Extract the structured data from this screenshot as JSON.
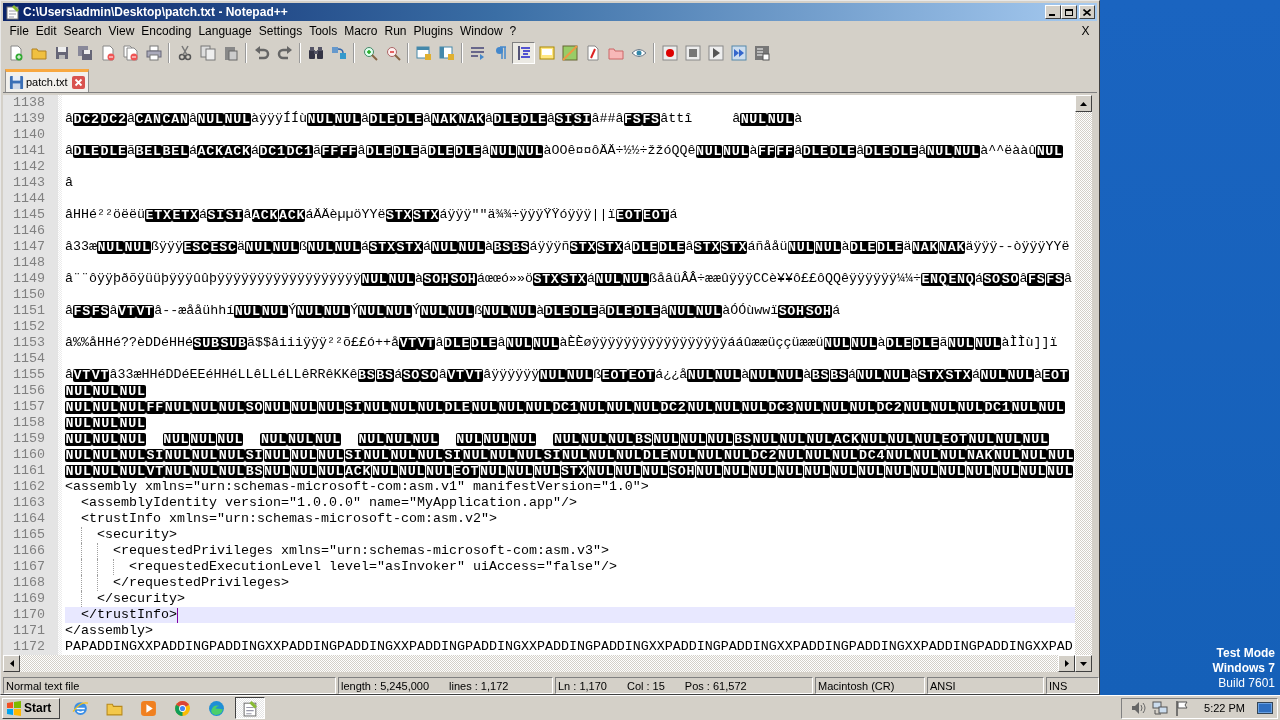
{
  "window": {
    "title": "C:\\Users\\admin\\Desktop\\patch.txt - Notepad++"
  },
  "menu": [
    "File",
    "Edit",
    "Search",
    "View",
    "Encoding",
    "Language",
    "Settings",
    "Tools",
    "Macro",
    "Run",
    "Plugins",
    "Window",
    "?"
  ],
  "menu_close": "X",
  "toolbar": [
    [
      {
        "pressed": false
      },
      {
        "pressed": false
      },
      {
        "pressed": false
      },
      {
        "pressed": false
      },
      {
        "pressed": false
      },
      {
        "pressed": false
      },
      {
        "pressed": false
      }
    ],
    [
      {
        "pressed": false
      },
      {
        "pressed": false
      },
      {
        "pressed": false
      }
    ],
    [
      {
        "pressed": false
      },
      {
        "pressed": false
      }
    ],
    [
      {
        "pressed": false
      },
      {
        "pressed": false
      }
    ],
    [
      {
        "pressed": false
      },
      {
        "pressed": false
      }
    ],
    [
      {
        "pressed": false
      },
      {
        "pressed": false
      }
    ],
    [
      {
        "pressed": false
      },
      {
        "pressed": false
      },
      {
        "pressed": true
      },
      {
        "pressed": false
      },
      {
        "pressed": false
      },
      {
        "pressed": false
      },
      {
        "pressed": false
      },
      {
        "pressed": false
      }
    ],
    [
      {
        "pressed": false
      },
      {
        "pressed": false
      },
      {
        "pressed": false
      },
      {
        "pressed": false
      },
      {
        "pressed": false
      }
    ]
  ],
  "tabs": [
    {
      "label": "patch.txt",
      "selected": true
    }
  ],
  "editor": {
    "lines": [
      {
        "number": "1138",
        "current": false
      },
      {
        "number": "1139",
        "current": false,
        "segments": [
          {
            "kind": "text",
            "text": "â"
          },
          {
            "kind": "ctrl",
            "codes": [
              "DC2",
              "DC2"
            ]
          },
          {
            "kind": "text",
            "text": "â"
          },
          {
            "kind": "ctrl",
            "codes": [
              "CAN",
              "CAN"
            ]
          },
          {
            "kind": "text",
            "text": "â"
          },
          {
            "kind": "ctrl",
            "codes": [
              "NUL",
              "NUL"
            ]
          },
          {
            "kind": "text",
            "text": "àÿÿÿÍÍù"
          },
          {
            "kind": "ctrl",
            "codes": [
              "NUL",
              "NUL"
            ]
          },
          {
            "kind": "text",
            "text": "â"
          },
          {
            "kind": "ctrl",
            "codes": [
              "DLE",
              "DLE"
            ]
          },
          {
            "kind": "text",
            "text": "â"
          },
          {
            "kind": "ctrl",
            "codes": [
              "NAK",
              "NAK"
            ]
          },
          {
            "kind": "text",
            "text": "â"
          },
          {
            "kind": "ctrl",
            "codes": [
              "DLE",
              "DLE"
            ]
          },
          {
            "kind": "text",
            "text": "â"
          },
          {
            "kind": "ctrl",
            "codes": [
              "SI",
              "SI"
            ]
          },
          {
            "kind": "text",
            "text": "â##â"
          },
          {
            "kind": "ctrl",
            "codes": [
              "FS",
              "FS"
            ]
          },
          {
            "kind": "text",
            "text": "âttî     â"
          },
          {
            "kind": "ctrl",
            "codes": [
              "NUL",
              "NUL"
            ]
          },
          {
            "kind": "text",
            "text": "à"
          }
        ]
      },
      {
        "number": "1140",
        "current": false
      },
      {
        "number": "1141",
        "current": false,
        "segments": [
          {
            "kind": "text",
            "text": "â"
          },
          {
            "kind": "ctrl",
            "codes": [
              "DLE",
              "DLE"
            ]
          },
          {
            "kind": "text",
            "text": "ã"
          },
          {
            "kind": "ctrl",
            "codes": [
              "BEL",
              "BEL"
            ]
          },
          {
            "kind": "text",
            "text": "á"
          },
          {
            "kind": "ctrl",
            "codes": [
              "ACK",
              "ACK"
            ]
          },
          {
            "kind": "text",
            "text": "á"
          },
          {
            "kind": "ctrl",
            "codes": [
              "DC1",
              "DC1"
            ]
          },
          {
            "kind": "text",
            "text": "ã"
          },
          {
            "kind": "ctrl",
            "codes": [
              "FF",
              "FF"
            ]
          },
          {
            "kind": "text",
            "text": "â"
          },
          {
            "kind": "ctrl",
            "codes": [
              "DLE",
              "DLE"
            ]
          },
          {
            "kind": "text",
            "text": "ã"
          },
          {
            "kind": "ctrl",
            "codes": [
              "DLE",
              "DLE"
            ]
          },
          {
            "kind": "text",
            "text": "â"
          },
          {
            "kind": "ctrl",
            "codes": [
              "NUL",
              "NUL"
            ]
          },
          {
            "kind": "text",
            "text": "àOOê¤¤ôÄÄ÷½½÷žžóQQê"
          },
          {
            "kind": "ctrl",
            "codes": [
              "NUL",
              "NUL"
            ]
          },
          {
            "kind": "text",
            "text": "à"
          },
          {
            "kind": "ctrl",
            "codes": [
              "FF",
              "FF"
            ]
          },
          {
            "kind": "text",
            "text": "â"
          },
          {
            "kind": "ctrl",
            "codes": [
              "DLE",
              "DLE"
            ]
          },
          {
            "kind": "text",
            "text": "â"
          },
          {
            "kind": "ctrl",
            "codes": [
              "DLE",
              "DLE"
            ]
          },
          {
            "kind": "text",
            "text": "â"
          },
          {
            "kind": "ctrl",
            "codes": [
              "NUL",
              "NUL"
            ]
          },
          {
            "kind": "text",
            "text": "à^^ëààû"
          },
          {
            "kind": "ctrl",
            "codes": [
              "NUL"
            ]
          }
        ]
      },
      {
        "number": "1142",
        "current": false
      },
      {
        "number": "1143",
        "current": false,
        "segments": [
          {
            "kind": "text",
            "text": "â"
          }
        ]
      },
      {
        "number": "1144",
        "current": false
      },
      {
        "number": "1145",
        "current": false,
        "segments": [
          {
            "kind": "text",
            "text": "âHHé²²öëëü"
          },
          {
            "kind": "ctrl",
            "codes": [
              "ETX",
              "ETX"
            ]
          },
          {
            "kind": "text",
            "text": "á"
          },
          {
            "kind": "ctrl",
            "codes": [
              "SI",
              "SI"
            ]
          },
          {
            "kind": "text",
            "text": "â"
          },
          {
            "kind": "ctrl",
            "codes": [
              "ACK",
              "ACK"
            ]
          },
          {
            "kind": "text",
            "text": "áÄÄèµµöYYë"
          },
          {
            "kind": "ctrl",
            "codes": [
              "STX",
              "STX"
            ]
          },
          {
            "kind": "text",
            "text": "áÿÿÿ\"\"ä¾¾÷ÿÿÿŸŸóÿÿÿ||ï"
          },
          {
            "kind": "ctrl",
            "codes": [
              "EOT",
              "EOT"
            ]
          },
          {
            "kind": "text",
            "text": "á"
          }
        ]
      },
      {
        "number": "1146",
        "current": false
      },
      {
        "number": "1147",
        "current": false,
        "segments": [
          {
            "kind": "text",
            "text": "â33æ"
          },
          {
            "kind": "ctrl",
            "codes": [
              "NUL",
              "NUL"
            ]
          },
          {
            "kind": "text",
            "text": "ßÿÿÿ"
          },
          {
            "kind": "ctrl",
            "codes": [
              "ESC",
              "ESC"
            ]
          },
          {
            "kind": "text",
            "text": "ä"
          },
          {
            "kind": "ctrl",
            "codes": [
              "NUL",
              "NUL"
            ]
          },
          {
            "kind": "text",
            "text": "ß"
          },
          {
            "kind": "ctrl",
            "codes": [
              "NUL",
              "NUL"
            ]
          },
          {
            "kind": "text",
            "text": "á"
          },
          {
            "kind": "ctrl",
            "codes": [
              "STX",
              "STX"
            ]
          },
          {
            "kind": "text",
            "text": "á"
          },
          {
            "kind": "ctrl",
            "codes": [
              "NUL",
              "NUL"
            ]
          },
          {
            "kind": "text",
            "text": "à"
          },
          {
            "kind": "ctrl",
            "codes": [
              "BS",
              "BS"
            ]
          },
          {
            "kind": "text",
            "text": "áÿÿÿñ"
          },
          {
            "kind": "ctrl",
            "codes": [
              "STX",
              "STX"
            ]
          },
          {
            "kind": "text",
            "text": "á"
          },
          {
            "kind": "ctrl",
            "codes": [
              "DLE",
              "DLE"
            ]
          },
          {
            "kind": "text",
            "text": "â"
          },
          {
            "kind": "ctrl",
            "codes": [
              "STX",
              "STX"
            ]
          },
          {
            "kind": "text",
            "text": "áñååü"
          },
          {
            "kind": "ctrl",
            "codes": [
              "NUL",
              "NUL"
            ]
          },
          {
            "kind": "text",
            "text": "à"
          },
          {
            "kind": "ctrl",
            "codes": [
              "DLE",
              "DLE"
            ]
          },
          {
            "kind": "text",
            "text": "ä"
          },
          {
            "kind": "ctrl",
            "codes": [
              "NAK",
              "NAK"
            ]
          },
          {
            "kind": "text",
            "text": "äÿÿÿ--òÿÿÿYYë"
          }
        ]
      },
      {
        "number": "1148",
        "current": false
      },
      {
        "number": "1149",
        "current": false,
        "segments": [
          {
            "kind": "text",
            "text": "â¨¨ôÿÿþðõÿüüþÿÿÿûûþÿÿÿÿÿÿÿÿÿÿÿÿÿÿÿÿÿÿ"
          },
          {
            "kind": "ctrl",
            "codes": [
              "NUL",
              "NUL"
            ]
          },
          {
            "kind": "text",
            "text": "à"
          },
          {
            "kind": "ctrl",
            "codes": [
              "SOH",
              "SOH"
            ]
          },
          {
            "kind": "text",
            "text": "áœœó»»ö"
          },
          {
            "kind": "ctrl",
            "codes": [
              "STX",
              "STX"
            ]
          },
          {
            "kind": "text",
            "text": "á"
          },
          {
            "kind": "ctrl",
            "codes": [
              "NUL",
              "NUL"
            ]
          },
          {
            "kind": "text",
            "text": "ßåâüÂÂ÷ææûÿÿÿCCè¥¥ô££ôQQêÿÿÿÿÿÿ¼¼÷"
          },
          {
            "kind": "ctrl",
            "codes": [
              "ENQ",
              "ENQ"
            ]
          },
          {
            "kind": "text",
            "text": "á"
          },
          {
            "kind": "ctrl",
            "codes": [
              "SO",
              "SO"
            ]
          },
          {
            "kind": "text",
            "text": "â"
          },
          {
            "kind": "ctrl",
            "codes": [
              "FS",
              "FS"
            ]
          },
          {
            "kind": "text",
            "text": "â"
          }
        ]
      },
      {
        "number": "1150",
        "current": false
      },
      {
        "number": "1151",
        "current": false,
        "segments": [
          {
            "kind": "text",
            "text": "â"
          },
          {
            "kind": "ctrl",
            "codes": [
              "FS",
              "FS"
            ]
          },
          {
            "kind": "text",
            "text": "â"
          },
          {
            "kind": "ctrl",
            "codes": [
              "VT",
              "VT"
            ]
          },
          {
            "kind": "text",
            "text": "â--æååühhí"
          },
          {
            "kind": "ctrl",
            "codes": [
              "NUL",
              "NUL"
            ]
          },
          {
            "kind": "text",
            "text": "Ý"
          },
          {
            "kind": "ctrl",
            "codes": [
              "NUL",
              "NUL"
            ]
          },
          {
            "kind": "text",
            "text": "Ý"
          },
          {
            "kind": "ctrl",
            "codes": [
              "NUL",
              "NUL"
            ]
          },
          {
            "kind": "text",
            "text": "Ý"
          },
          {
            "kind": "ctrl",
            "codes": [
              "NUL",
              "NUL"
            ]
          },
          {
            "kind": "text",
            "text": "ß"
          },
          {
            "kind": "ctrl",
            "codes": [
              "NUL",
              "NUL"
            ]
          },
          {
            "kind": "text",
            "text": "à"
          },
          {
            "kind": "ctrl",
            "codes": [
              "DLE",
              "DLE"
            ]
          },
          {
            "kind": "text",
            "text": "ã"
          },
          {
            "kind": "ctrl",
            "codes": [
              "DLE",
              "DLE"
            ]
          },
          {
            "kind": "text",
            "text": "â"
          },
          {
            "kind": "ctrl",
            "codes": [
              "NUL",
              "NUL"
            ]
          },
          {
            "kind": "text",
            "text": "àÓÓùwwï"
          },
          {
            "kind": "ctrl",
            "codes": [
              "SOH",
              "SOH"
            ]
          },
          {
            "kind": "text",
            "text": "á"
          }
        ]
      },
      {
        "number": "1152",
        "current": false
      },
      {
        "number": "1153",
        "current": false,
        "segments": [
          {
            "kind": "text",
            "text": "â%%åHHé??èDDéHHé"
          },
          {
            "kind": "ctrl",
            "codes": [
              "SUB",
              "SUB"
            ]
          },
          {
            "kind": "text",
            "text": "ã$$âiiiÿÿÿ²²õ££ó++å"
          },
          {
            "kind": "ctrl",
            "codes": [
              "VT",
              "VT"
            ]
          },
          {
            "kind": "text",
            "text": "â"
          },
          {
            "kind": "ctrl",
            "codes": [
              "DLE",
              "DLE"
            ]
          },
          {
            "kind": "text",
            "text": "â"
          },
          {
            "kind": "ctrl",
            "codes": [
              "NUL",
              "NUL"
            ]
          },
          {
            "kind": "text",
            "text": "àÈÈøÿÿÿÿÿÿÿÿÿÿÿÿÿÿÿÿÿááûææüççüææü"
          },
          {
            "kind": "ctrl",
            "codes": [
              "NUL",
              "NUL"
            ]
          },
          {
            "kind": "text",
            "text": "à"
          },
          {
            "kind": "ctrl",
            "codes": [
              "DLE",
              "DLE"
            ]
          },
          {
            "kind": "text",
            "text": "ã"
          },
          {
            "kind": "ctrl",
            "codes": [
              "NUL",
              "NUL"
            ]
          },
          {
            "kind": "text",
            "text": "àÌÌù]]ï"
          }
        ]
      },
      {
        "number": "1154",
        "current": false
      },
      {
        "number": "1155",
        "current": false,
        "segments": [
          {
            "kind": "text",
            "text": "â"
          },
          {
            "kind": "ctrl",
            "codes": [
              "VT",
              "VT"
            ]
          },
          {
            "kind": "text",
            "text": "â33æHHéDDéEEéHHéLLêLLéLLêRRêKKê"
          },
          {
            "kind": "ctrl",
            "codes": [
              "BS",
              "BS"
            ]
          },
          {
            "kind": "text",
            "text": "á"
          },
          {
            "kind": "ctrl",
            "codes": [
              "SO",
              "SO"
            ]
          },
          {
            "kind": "text",
            "text": "â"
          },
          {
            "kind": "ctrl",
            "codes": [
              "VT",
              "VT"
            ]
          },
          {
            "kind": "text",
            "text": "âÿÿÿÿÿÿ"
          },
          {
            "kind": "ctrl",
            "codes": [
              "NUL",
              "NUL"
            ]
          },
          {
            "kind": "text",
            "text": "ß"
          },
          {
            "kind": "ctrl",
            "codes": [
              "EOT",
              "EOT"
            ]
          },
          {
            "kind": "text",
            "text": "á¿¿å"
          },
          {
            "kind": "ctrl",
            "codes": [
              "NUL",
              "NUL"
            ]
          },
          {
            "kind": "text",
            "text": "à"
          },
          {
            "kind": "ctrl",
            "codes": [
              "NUL",
              "NUL"
            ]
          },
          {
            "kind": "text",
            "text": "à"
          },
          {
            "kind": "ctrl",
            "codes": [
              "BS",
              "BS"
            ]
          },
          {
            "kind": "text",
            "text": "á"
          },
          {
            "kind": "ctrl",
            "codes": [
              "NUL",
              "NUL"
            ]
          },
          {
            "kind": "text",
            "text": "à"
          },
          {
            "kind": "ctrl",
            "codes": [
              "STX",
              "STX"
            ]
          },
          {
            "kind": "text",
            "text": "á"
          },
          {
            "kind": "ctrl",
            "codes": [
              "NUL",
              "NUL"
            ]
          },
          {
            "kind": "text",
            "text": "à"
          },
          {
            "kind": "ctrl",
            "codes": [
              "EOT"
            ]
          }
        ]
      },
      {
        "number": "1156",
        "current": false,
        "segments": [
          {
            "kind": "ctrl",
            "codes": [
              "NUL",
              "NUL",
              "NUL"
            ]
          }
        ]
      },
      {
        "number": "1157",
        "current": false,
        "segments": [
          {
            "kind": "ctrl",
            "codes": [
              "NUL",
              "NUL",
              "NUL",
              "FF",
              "NUL",
              "NUL",
              "NUL",
              "SO",
              "NUL",
              "NUL",
              "NUL",
              "SI",
              "NUL",
              "NUL",
              "NUL",
              "DLE",
              "NUL",
              "NUL",
              "NUL",
              "DC1",
              "NUL",
              "NUL",
              "NUL",
              "DC2",
              "NUL",
              "NUL",
              "NUL",
              "DC3",
              "NUL",
              "NUL",
              "NUL",
              "DC2",
              "NUL",
              "NUL",
              "NUL",
              "DC1",
              "NUL",
              "NUL"
            ]
          }
        ]
      },
      {
        "number": "1158",
        "current": false,
        "segments": [
          {
            "kind": "ctrl",
            "codes": [
              "NUL",
              "NUL",
              "NUL"
            ]
          }
        ]
      },
      {
        "number": "1159",
        "current": false,
        "segments": [
          {
            "kind": "ctrl",
            "codes": [
              "NUL",
              "NUL",
              "NUL"
            ]
          },
          {
            "kind": "gap"
          },
          {
            "kind": "ctrl",
            "codes": [
              "NUL",
              "NUL",
              "NUL"
            ]
          },
          {
            "kind": "gap"
          },
          {
            "kind": "ctrl",
            "codes": [
              "NUL",
              "NUL",
              "NUL"
            ]
          },
          {
            "kind": "gap"
          },
          {
            "kind": "ctrl",
            "codes": [
              "NUL",
              "NUL",
              "NUL"
            ]
          },
          {
            "kind": "gap"
          },
          {
            "kind": "ctrl",
            "codes": [
              "NUL",
              "NUL",
              "NUL"
            ]
          },
          {
            "kind": "gap"
          },
          {
            "kind": "ctrl",
            "codes": [
              "NUL",
              "NUL",
              "NUL",
              "BS",
              "NUL",
              "NUL",
              "NUL",
              "BS",
              "NUL",
              "NUL",
              "NUL",
              "ACK",
              "NUL",
              "NUL",
              "NUL",
              "EOT",
              "NUL",
              "NUL",
              "NUL"
            ]
          }
        ]
      },
      {
        "number": "1160",
        "current": false,
        "segments": [
          {
            "kind": "ctrl",
            "codes": [
              "NUL",
              "NUL",
              "NUL",
              "SI",
              "NUL",
              "NUL",
              "NUL",
              "SI",
              "NUL",
              "NUL",
              "NUL",
              "SI",
              "NUL",
              "NUL",
              "NUL",
              "SI",
              "NUL",
              "NUL",
              "NUL",
              "SI",
              "NUL",
              "NUL",
              "NUL",
              "DLE",
              "NUL",
              "NUL",
              "NUL",
              "DC2",
              "NUL",
              "NUL",
              "NUL",
              "DC4",
              "NUL",
              "NUL",
              "NUL",
              "NAK",
              "NUL",
              "NUL",
              "NUL"
            ]
          }
        ]
      },
      {
        "number": "1161",
        "current": false,
        "segments": [
          {
            "kind": "ctrl",
            "codes": [
              "NUL",
              "NUL",
              "NUL",
              "VT",
              "NUL",
              "NUL",
              "NUL",
              "BS",
              "NUL",
              "NUL",
              "NUL",
              "ACK",
              "NUL",
              "NUL",
              "NUL",
              "EOT",
              "NUL",
              "NUL",
              "NUL",
              "STX",
              "NUL",
              "NUL",
              "NUL",
              "SOH",
              "NUL",
              "NUL",
              "NUL",
              "NUL",
              "NUL",
              "NUL",
              "NUL",
              "NUL",
              "NUL",
              "NUL",
              "NUL",
              "NUL",
              "NUL",
              "NUL"
            ]
          }
        ]
      },
      {
        "number": "1162",
        "current": false,
        "segments": [
          {
            "kind": "text",
            "text": "<assembly xmlns=\"urn:schemas-microsoft-com:asm.v1\" manifestVersion=\"1.0\">"
          }
        ]
      },
      {
        "number": "1163",
        "current": false,
        "segments": [
          {
            "kind": "text",
            "text": "  <assemblyIdentity version=\"1.0.0.0\" name=\"MyApplication.app\"/>"
          }
        ]
      },
      {
        "number": "1164",
        "current": false,
        "segments": [
          {
            "kind": "text",
            "text": "  <trustInfo xmlns=\"urn:schemas-microsoft-com:asm.v2\">"
          }
        ]
      },
      {
        "number": "1165",
        "current": false,
        "segments": [
          {
            "kind": "text",
            "text": "    <security>"
          }
        ]
      },
      {
        "number": "1166",
        "current": false,
        "segments": [
          {
            "kind": "text",
            "text": "      <requestedPrivileges xmlns=\"urn:schemas-microsoft-com:asm.v3\">"
          }
        ]
      },
      {
        "number": "1167",
        "current": false,
        "segments": [
          {
            "kind": "text",
            "text": "        <requestedExecutionLevel level=\"asInvoker\" uiAccess=\"false\"/>"
          }
        ]
      },
      {
        "number": "1168",
        "current": false,
        "segments": [
          {
            "kind": "text",
            "text": "      </requestedPrivileges>"
          }
        ]
      },
      {
        "number": "1169",
        "current": false,
        "segments": [
          {
            "kind": "text",
            "text": "    </security>"
          }
        ]
      },
      {
        "number": "1170",
        "current": true,
        "segments": [
          {
            "kind": "text",
            "text": "  </trustInfo>"
          }
        ]
      },
      {
        "number": "1171",
        "current": false,
        "segments": [
          {
            "kind": "text",
            "text": "</assembly>"
          }
        ]
      },
      {
        "number": "1172",
        "current": false,
        "segments": [
          {
            "kind": "text",
            "text": "PAPADDINGXXPADDINGPADDINGXXPADDINGPADDINGXXPADDINGPADDINGXXPADDINGPADDINGXXPADDINGPADDINGXXPADDINGPADDINGXXPADDINGPADDINGXXPAD"
          }
        ]
      }
    ]
  },
  "status_bar": [
    [
      "Normal text file"
    ],
    [
      "length : 5,245,000",
      "lines : 1,172"
    ],
    [
      "Ln : 1,170",
      "Col : 15",
      "Pos : 61,572"
    ],
    [
      "Macintosh (CR)"
    ],
    [
      "ANSI"
    ],
    [
      "INS"
    ]
  ],
  "desktop": {
    "notice": [
      "Test Mode",
      "Windows 7",
      "Build 7601"
    ]
  },
  "taskbar": {
    "start": "Start",
    "apps": [
      {
        "selected": false
      },
      {
        "selected": false
      },
      {
        "selected": false
      },
      {
        "selected": false
      },
      {
        "selected": false
      },
      {
        "selected": true
      }
    ],
    "clock": "5:22 PM"
  }
}
